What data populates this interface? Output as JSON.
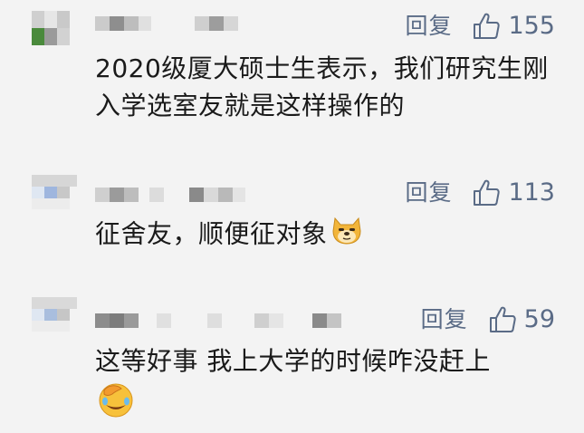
{
  "comments": [
    {
      "reply_label": "回复",
      "like_count": "155",
      "text": "2020级厦大硕士生表示，我们研究生刚入学选室友就是这样操作的",
      "emoji": ""
    },
    {
      "reply_label": "回复",
      "like_count": "113",
      "text": "征舍友，顺便征对象",
      "emoji": "doge-emoji"
    },
    {
      "reply_label": "回复",
      "like_count": "59",
      "text": "这等好事 我上大学的时候咋没赶上",
      "emoji": "facepalm-laugh-emoji"
    }
  ]
}
